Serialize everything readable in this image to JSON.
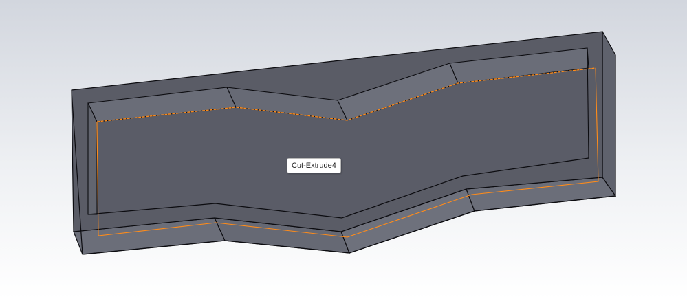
{
  "viewport": {
    "background_top": "#d2d6de",
    "background_bottom": "#ffffff"
  },
  "part": {
    "face_colors": {
      "top_rim": "#5a5c66",
      "pocket_floor": "#5a5c67",
      "pocket_wall": "#6a6d78",
      "outer_side": "#6b6e79",
      "end_face": "#5f626d",
      "edges": "#0c0c10"
    },
    "highlight_color": "#ff8c1a"
  },
  "tooltip": {
    "text": "Cut-Extrude4"
  }
}
